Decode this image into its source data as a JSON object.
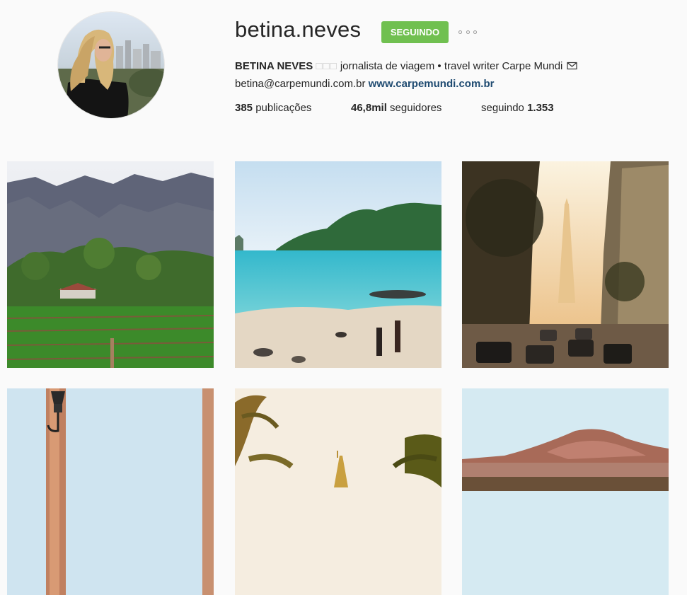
{
  "profile": {
    "username": "betina.neves",
    "follow_button": "SEGUINDO",
    "more_options_icon": "more-horizontal-icon",
    "full_name": "BETINA NEVES",
    "name_glyphs": "□□□",
    "bio_text": "jornalista de viagem • travel writer Carpe Mundi",
    "bio_icon": "envelope-icon",
    "email": "betina@carpemundi.com.br",
    "website": "www.carpemundi.com.br"
  },
  "stats": {
    "posts_count": "385",
    "posts_label": "publicações",
    "followers_count": "46,8mil",
    "followers_label": "seguidores",
    "following_label": "seguindo",
    "following_count": "1.353"
  },
  "colors": {
    "follow_green": "#70c050",
    "link_blue": "#1f4b71",
    "background": "#fafafa"
  },
  "posts": [
    {
      "subject": "mountain-farm-photo"
    },
    {
      "subject": "tropical-beach-photo"
    },
    {
      "subject": "city-avenue-obelisk-photo"
    },
    {
      "subject": "street-lamp-wall-photo"
    },
    {
      "subject": "palm-trees-pagoda-photo"
    },
    {
      "subject": "desert-mountain-photo"
    }
  ]
}
